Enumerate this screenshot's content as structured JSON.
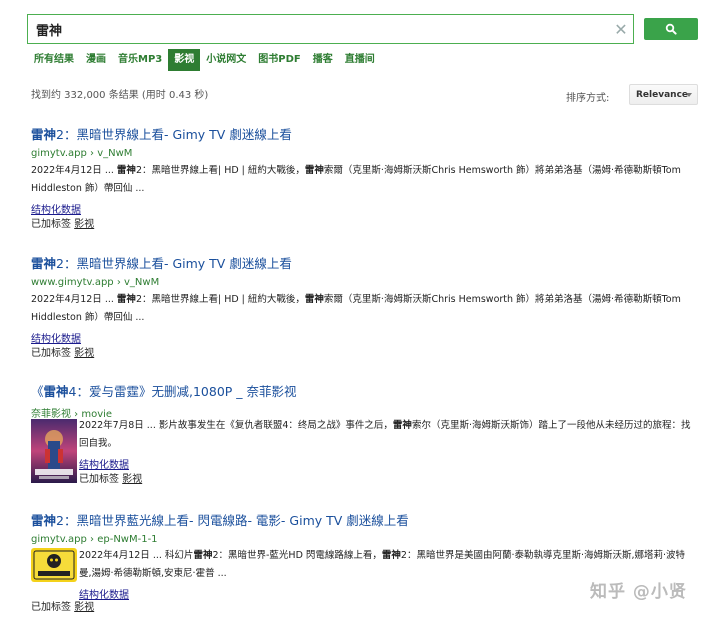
{
  "search": {
    "query": "雷神",
    "clear_symbol": "✕"
  },
  "tabs": [
    {
      "label": "所有结果",
      "active": false
    },
    {
      "label": "漫画",
      "active": false
    },
    {
      "label": "音乐MP3",
      "active": false
    },
    {
      "label": "影视",
      "active": true
    },
    {
      "label": "小说网文",
      "active": false
    },
    {
      "label": "图书PDF",
      "active": false
    },
    {
      "label": "播客",
      "active": false
    },
    {
      "label": "直播间",
      "active": false
    }
  ],
  "stats": "找到约 332,000 条结果 (用时 0.43 秒)",
  "sort": {
    "label": "排序方式:",
    "value": "Relevance"
  },
  "results": [
    {
      "title_hl": "雷神",
      "title_rest": "2：黑暗世界線上看- Gimy TV 劇迷線上看",
      "url": "gimytv.app › v_NwM",
      "date": "2022年4月12日 ... ",
      "s1": "雷神",
      "s2": "2：黑暗世界線上看| HD | 紐約大戰後，",
      "s3": "雷神",
      "s4": "索爾（克里斯·海姆斯沃斯Chris Hemsworth 飾）將弟弟洛基（湯姆·希德勒斯頓Tom Hiddleston 飾）帶回仙 ...",
      "structured": "结构化数据",
      "label_prefix": "已加标签",
      "tag": "影视"
    },
    {
      "title_hl": "雷神",
      "title_rest": "2：黑暗世界線上看- Gimy TV 劇迷線上看",
      "url": "www.gimytv.app › v_NwM",
      "date": "2022年4月12日 ... ",
      "s1": "雷神",
      "s2": "2：黑暗世界線上看| HD | 紐約大戰後，",
      "s3": "雷神",
      "s4": "索爾（克里斯·海姆斯沃斯Chris Hemsworth 飾）將弟弟洛基（湯姆·希德勒斯頓Tom Hiddleston 飾）帶回仙 ...",
      "structured": "结构化数据",
      "label_prefix": "已加标签",
      "tag": "影视"
    },
    {
      "title_pre": "《",
      "title_hl": "雷神",
      "title_rest": "4：爱与雷霆》无删减,1080P _ 奈菲影视",
      "url": "奈菲影视 › movie",
      "date": "2022年7月8日 ... ",
      "s1": "",
      "s2": "影片故事发生在《复仇者联盟4：终局之战》事件之后，",
      "s3": "雷神",
      "s4": "索尔（克里斯·海姆斯沃斯饰）踏上了一段他从未经历过的旅程：找回自我。",
      "structured": "结构化数据",
      "label_prefix": "已加标签",
      "tag": "影视"
    },
    {
      "title_hl": "雷神",
      "title_rest": "2：黑暗世界藍光線上看- 閃電線路- 電影- Gimy TV 劇迷線上看",
      "url": "gimytv.app › ep-NwM-1-1",
      "date": "2022年4月12日 ... ",
      "s1": "",
      "s2": "科幻片",
      "s3": "雷神",
      "s4": "2：黑暗世界-藍光HD 閃電線路線上看，",
      "s5": "雷神",
      "s6": "2：黑暗世界是美國由阿蘭·泰勒執導克里斯·海姆斯沃斯,娜塔莉·波特曼,湯姆·希德勒斯頓,安東尼·霍普 ...",
      "structured": "结构化数据",
      "label_prefix": "已加标签",
      "tag": "影视"
    }
  ],
  "watermark": "知乎 @小贤"
}
